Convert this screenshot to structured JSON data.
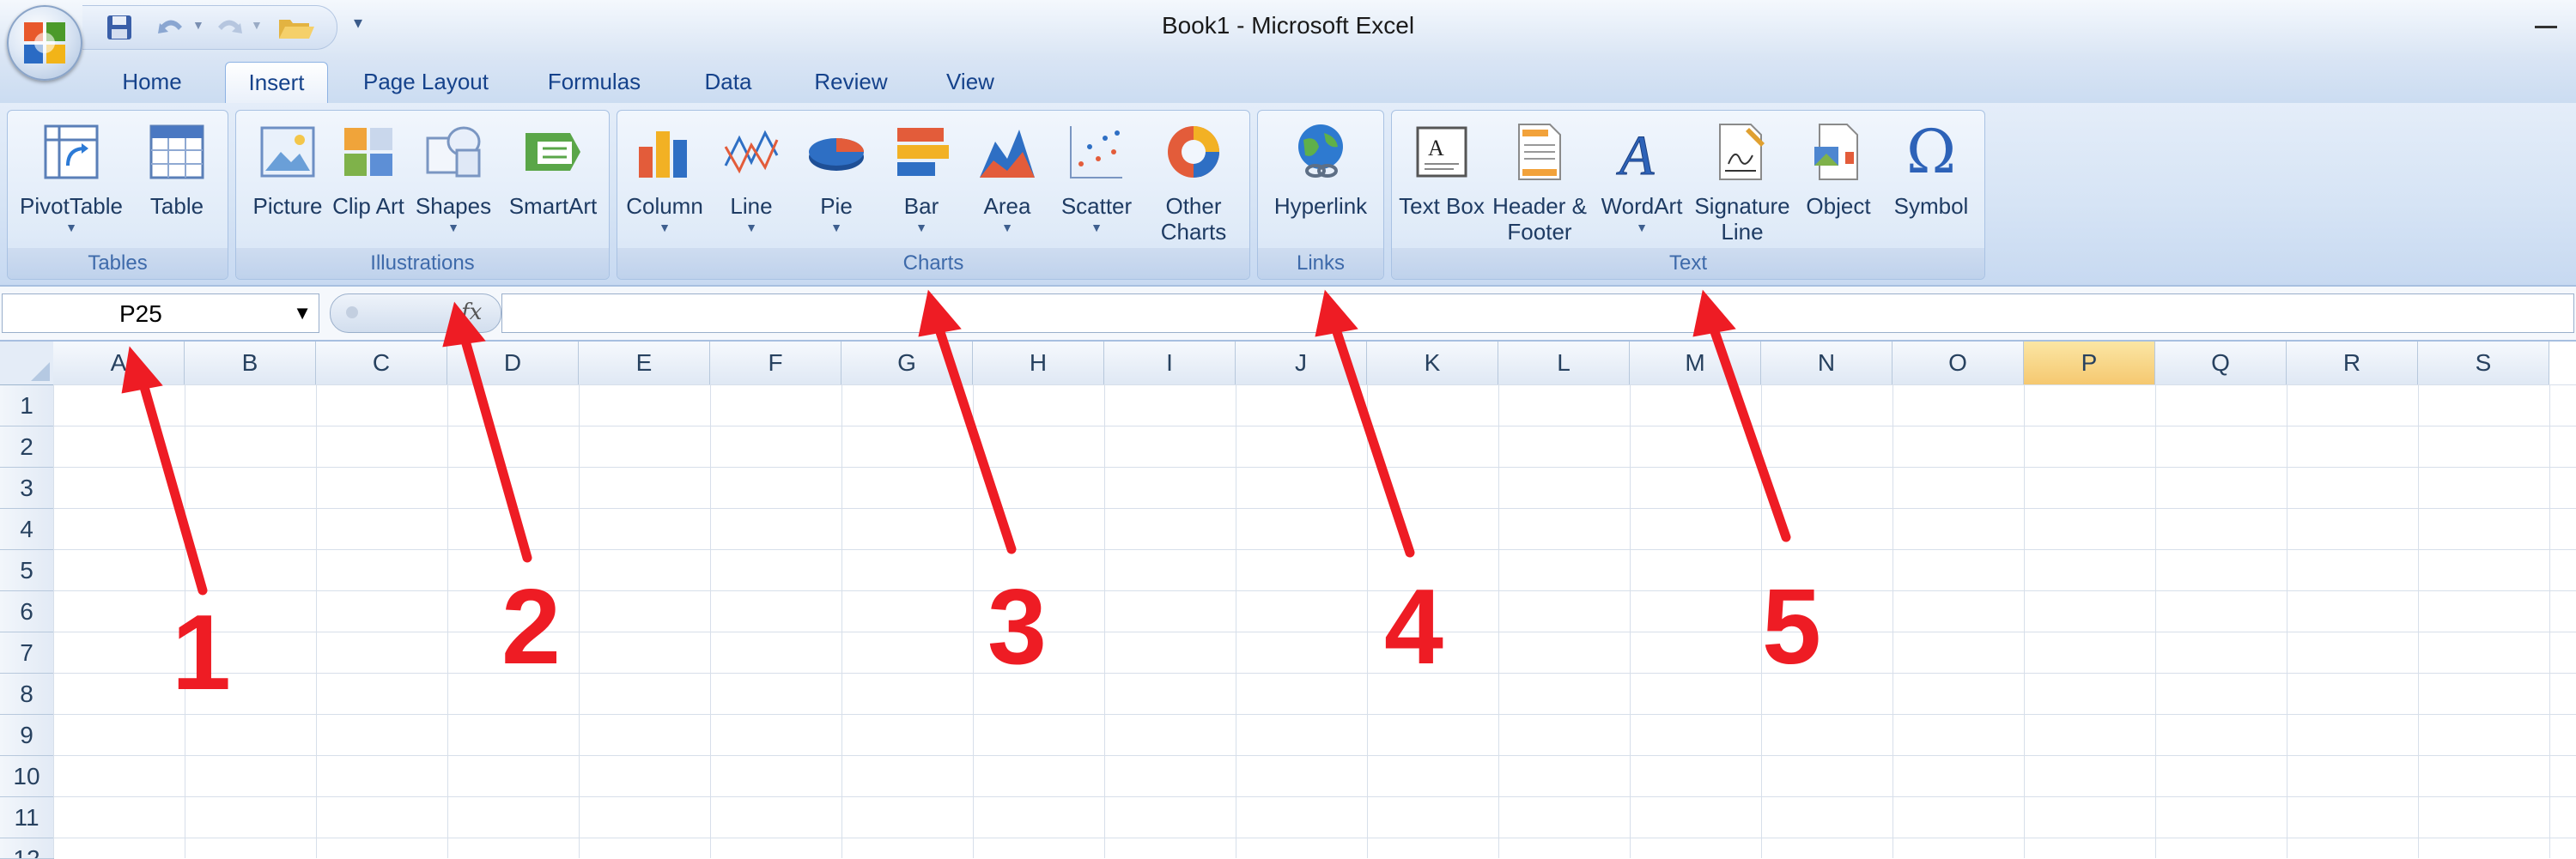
{
  "window": {
    "title": "Book1 - Microsoft Excel"
  },
  "tabs": [
    {
      "label": "Home"
    },
    {
      "label": "Insert",
      "active": true
    },
    {
      "label": "Page Layout"
    },
    {
      "label": "Formulas"
    },
    {
      "label": "Data"
    },
    {
      "label": "Review"
    },
    {
      "label": "View"
    }
  ],
  "ribbon": {
    "groups": [
      {
        "label": "Tables",
        "buttons": [
          {
            "label": "PivotTable",
            "icon": "pivottable-icon"
          },
          {
            "label": "Table",
            "icon": "table-icon"
          }
        ]
      },
      {
        "label": "Illustrations",
        "buttons": [
          {
            "label": "Picture",
            "icon": "picture-icon"
          },
          {
            "label": "Clip Art",
            "icon": "clipart-icon"
          },
          {
            "label": "Shapes",
            "icon": "shapes-icon"
          },
          {
            "label": "SmartArt",
            "icon": "smartart-icon"
          }
        ]
      },
      {
        "label": "Charts",
        "buttons": [
          {
            "label": "Column",
            "icon": "column-chart-icon"
          },
          {
            "label": "Line",
            "icon": "line-chart-icon"
          },
          {
            "label": "Pie",
            "icon": "pie-chart-icon"
          },
          {
            "label": "Bar",
            "icon": "bar-chart-icon"
          },
          {
            "label": "Area",
            "icon": "area-chart-icon"
          },
          {
            "label": "Scatter",
            "icon": "scatter-chart-icon"
          },
          {
            "label": "Other Charts",
            "icon": "other-charts-icon"
          }
        ]
      },
      {
        "label": "Links",
        "buttons": [
          {
            "label": "Hyperlink",
            "icon": "hyperlink-icon"
          }
        ]
      },
      {
        "label": "Text",
        "buttons": [
          {
            "label": "Text Box",
            "icon": "textbox-icon"
          },
          {
            "label": "Header & Footer",
            "icon": "header-footer-icon"
          },
          {
            "label": "WordArt",
            "icon": "wordart-icon"
          },
          {
            "label": "Signature Line",
            "icon": "signature-line-icon"
          },
          {
            "label": "Object",
            "icon": "object-icon"
          },
          {
            "label": "Symbol",
            "icon": "Ω"
          }
        ]
      }
    ]
  },
  "formula_bar": {
    "name_box": "P25",
    "fx": "fx",
    "value": ""
  },
  "sheet": {
    "columns": [
      "A",
      "B",
      "C",
      "D",
      "E",
      "F",
      "G",
      "H",
      "I",
      "J",
      "K",
      "L",
      "M",
      "N",
      "O",
      "P",
      "Q",
      "R",
      "S"
    ],
    "selected_column": "P",
    "rows": [
      "1",
      "2",
      "3",
      "4",
      "5",
      "6",
      "7",
      "8",
      "9",
      "10",
      "11",
      "12"
    ]
  },
  "annotations": [
    "1",
    "2",
    "3",
    "4",
    "5"
  ],
  "colors": {
    "annotation": "#ee1c24",
    "selected_header": "#f5c870",
    "ribbon_text": "#15428b"
  }
}
